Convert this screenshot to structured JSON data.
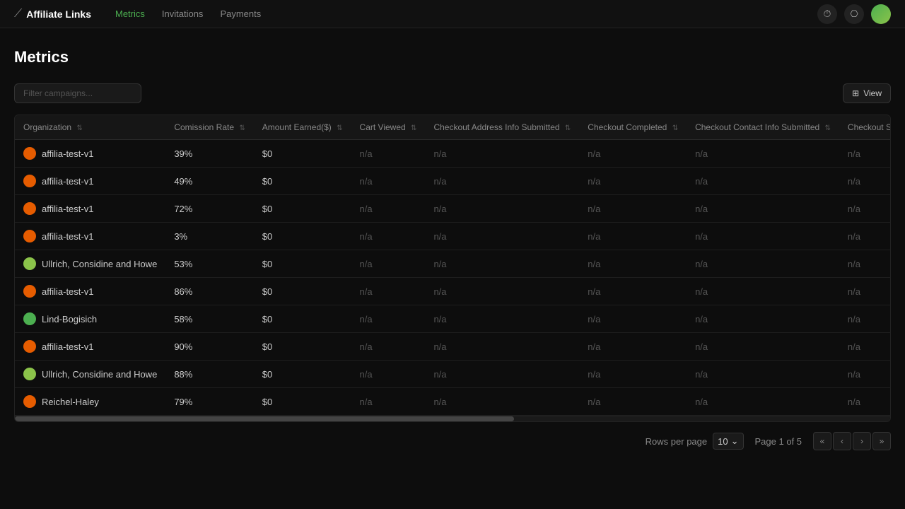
{
  "app": {
    "logo_icon": "⟋",
    "logo_text": "Affiliate Links"
  },
  "nav": {
    "items": [
      {
        "label": "Metrics",
        "active": true
      },
      {
        "label": "Invitations",
        "active": false
      },
      {
        "label": "Payments",
        "active": false
      }
    ]
  },
  "header_actions": {
    "icon1": "⏱",
    "icon2": "⎔"
  },
  "page": {
    "title": "Metrics"
  },
  "toolbar": {
    "filter_placeholder": "Filter campaigns...",
    "view_label": "View"
  },
  "table": {
    "columns": [
      {
        "key": "org",
        "label": "Organization"
      },
      {
        "key": "commission",
        "label": "Comission Rate"
      },
      {
        "key": "amount",
        "label": "Amount Earned($)"
      },
      {
        "key": "cart",
        "label": "Cart Viewed"
      },
      {
        "key": "checkout_addr",
        "label": "Checkout Address Info Submitted"
      },
      {
        "key": "checkout_complete",
        "label": "Checkout Completed"
      },
      {
        "key": "checkout_contact",
        "label": "Checkout Contact Info Submitted"
      },
      {
        "key": "checkout_shipping",
        "label": "Checkout Shipping Info Submitted"
      }
    ],
    "rows": [
      {
        "org": "affilia-test-v1",
        "dot_color": "#e65c00",
        "commission": "39%",
        "amount": "$0",
        "cart": "n/a",
        "checkout_addr": "n/a",
        "checkout_complete": "n/a",
        "checkout_contact": "n/a",
        "checkout_shipping": "n/a"
      },
      {
        "org": "affilia-test-v1",
        "dot_color": "#e65c00",
        "commission": "49%",
        "amount": "$0",
        "cart": "n/a",
        "checkout_addr": "n/a",
        "checkout_complete": "n/a",
        "checkout_contact": "n/a",
        "checkout_shipping": "n/a"
      },
      {
        "org": "affilia-test-v1",
        "dot_color": "#e65c00",
        "commission": "72%",
        "amount": "$0",
        "cart": "n/a",
        "checkout_addr": "n/a",
        "checkout_complete": "n/a",
        "checkout_contact": "n/a",
        "checkout_shipping": "n/a"
      },
      {
        "org": "affilia-test-v1",
        "dot_color": "#e65c00",
        "commission": "3%",
        "amount": "$0",
        "cart": "n/a",
        "checkout_addr": "n/a",
        "checkout_complete": "n/a",
        "checkout_contact": "n/a",
        "checkout_shipping": "n/a"
      },
      {
        "org": "Ullrich, Considine and Howe",
        "dot_color": "#8bc34a",
        "commission": "53%",
        "amount": "$0",
        "cart": "n/a",
        "checkout_addr": "n/a",
        "checkout_complete": "n/a",
        "checkout_contact": "n/a",
        "checkout_shipping": "n/a"
      },
      {
        "org": "affilia-test-v1",
        "dot_color": "#e65c00",
        "commission": "86%",
        "amount": "$0",
        "cart": "n/a",
        "checkout_addr": "n/a",
        "checkout_complete": "n/a",
        "checkout_contact": "n/a",
        "checkout_shipping": "n/a"
      },
      {
        "org": "Lind-Bogisich",
        "dot_color": "#4caf50",
        "commission": "58%",
        "amount": "$0",
        "cart": "n/a",
        "checkout_addr": "n/a",
        "checkout_complete": "n/a",
        "checkout_contact": "n/a",
        "checkout_shipping": "n/a"
      },
      {
        "org": "affilia-test-v1",
        "dot_color": "#e65c00",
        "commission": "90%",
        "amount": "$0",
        "cart": "n/a",
        "checkout_addr": "n/a",
        "checkout_complete": "n/a",
        "checkout_contact": "n/a",
        "checkout_shipping": "n/a"
      },
      {
        "org": "Ullrich, Considine and Howe",
        "dot_color": "#8bc34a",
        "commission": "88%",
        "amount": "$0",
        "cart": "n/a",
        "checkout_addr": "n/a",
        "checkout_complete": "n/a",
        "checkout_contact": "n/a",
        "checkout_shipping": "n/a"
      },
      {
        "org": "Reichel-Haley",
        "dot_color": "#e65c00",
        "commission": "79%",
        "amount": "$0",
        "cart": "n/a",
        "checkout_addr": "n/a",
        "checkout_complete": "n/a",
        "checkout_contact": "n/a",
        "checkout_shipping": "n/a"
      }
    ]
  },
  "pagination": {
    "rows_per_page_label": "Rows per page",
    "rows_per_page_value": "10",
    "page_info": "Page 1 of 5"
  }
}
